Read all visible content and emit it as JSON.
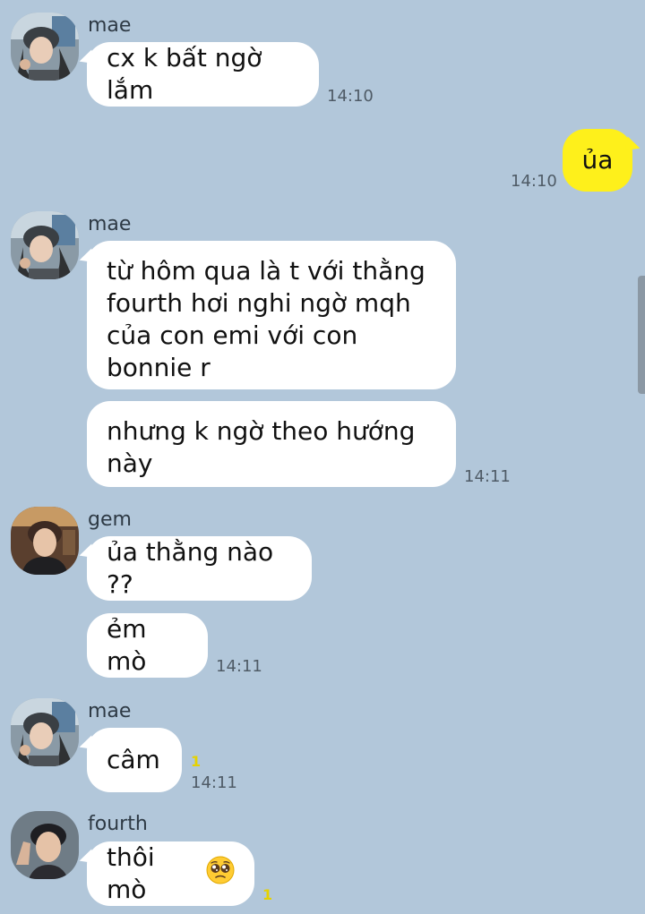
{
  "messages": [
    {
      "sender": "mae",
      "text": "cx k bất ngờ lắm",
      "time": "14:10"
    },
    {
      "text": "ủa",
      "time": "14:10"
    },
    {
      "sender": "mae",
      "text": "từ hôm qua là t với thằng fourth hơi nghi ngờ mqh của con emi với con bonnie r"
    },
    {
      "text": "nhưng k ngờ theo hướng này",
      "time": "14:11"
    },
    {
      "sender": "gem",
      "text": "ủa thằng nào ??"
    },
    {
      "text": "ẻm mò",
      "time": "14:11"
    },
    {
      "sender": "mae",
      "text": "câm",
      "time": "14:11",
      "unread": "1"
    },
    {
      "sender": "fourth",
      "text": "thôi mò",
      "unread": "1",
      "emoji_icon": "pleading-face-emoji"
    }
  ],
  "icons": {
    "avatar_mae": "avatar-mae-icon",
    "avatar_gem": "avatar-gem-icon",
    "avatar_fourth": "avatar-fourth-icon"
  },
  "colors": {
    "background": "#b2c7da",
    "incoming_bubble": "#ffffff",
    "outgoing_bubble": "#fef01b",
    "unread_count": "#e6d200"
  }
}
